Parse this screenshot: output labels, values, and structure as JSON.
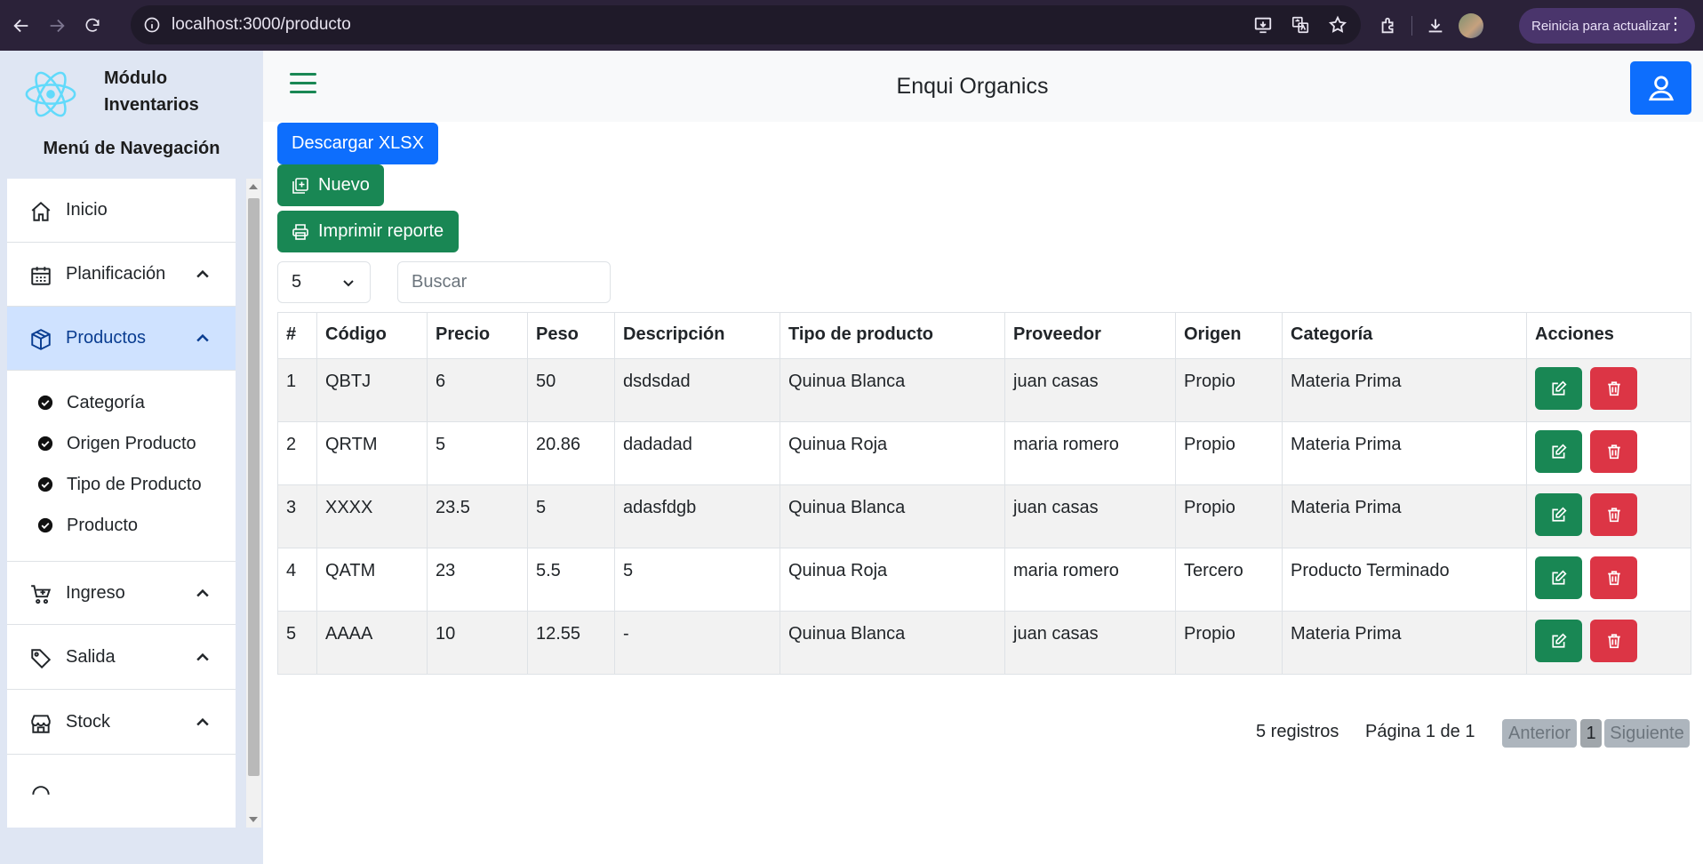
{
  "browser": {
    "url": "localhost:3000/producto",
    "update_label": "Reinicia para actualizar",
    "icons": [
      "back-icon",
      "forward-icon",
      "reload-icon",
      "info-icon",
      "install-icon",
      "translate-icon",
      "star-icon",
      "extensions-icon",
      "download-icon",
      "profile-avatar",
      "menu-dots-icon"
    ]
  },
  "sidebar": {
    "brand_title": "Módulo Inventarios",
    "menu_title": "Menú de Navegación",
    "items": [
      {
        "label": "Inicio",
        "icon": "home-icon"
      },
      {
        "label": "Planificación",
        "icon": "calendar-icon"
      },
      {
        "label": "Productos",
        "icon": "box-icon"
      },
      {
        "label": "Ingreso",
        "icon": "cart-plus-icon"
      },
      {
        "label": "Salida",
        "icon": "tag-icon"
      },
      {
        "label": "Stock",
        "icon": "shop-icon"
      }
    ],
    "subitems": [
      {
        "label": "Categoría"
      },
      {
        "label": "Origen Producto"
      },
      {
        "label": "Tipo de Producto"
      },
      {
        "label": "Producto"
      }
    ]
  },
  "header": {
    "title": "Enqui Organics"
  },
  "toolbar": {
    "download_label": "Descargar XLSX",
    "new_label": "Nuevo",
    "print_label": "Imprimir reporte",
    "page_size": "5",
    "search_placeholder": "Buscar"
  },
  "table": {
    "columns": [
      "#",
      "Código",
      "Precio",
      "Peso",
      "Descripción",
      "Tipo de producto",
      "Proveedor",
      "Origen",
      "Categoría",
      "Acciones"
    ],
    "rows": [
      [
        "1",
        "QBTJ",
        "6",
        "50",
        "dsdsdad",
        "Quinua Blanca",
        "juan casas",
        "Propio",
        "Materia Prima"
      ],
      [
        "2",
        "QRTM",
        "5",
        "20.86",
        "dadadad",
        "Quinua Roja",
        "maria romero",
        "Propio",
        "Materia Prima"
      ],
      [
        "3",
        "XXXX",
        "23.5",
        "5",
        "adasfdgb",
        "Quinua Blanca",
        "juan casas",
        "Propio",
        "Materia Prima"
      ],
      [
        "4",
        "QATM",
        "23",
        "5.5",
        "5",
        "Quinua Roja",
        "maria romero",
        "Tercero",
        "Producto Terminado"
      ],
      [
        "5",
        "AAAA",
        "10",
        "12.55",
        "-",
        "Quinua Blanca",
        "juan casas",
        "Propio",
        "Materia Prima"
      ]
    ]
  },
  "pagination": {
    "records": "5 registros",
    "page_info": "Página 1 de 1",
    "prev_label": "Anterior",
    "current_page": "1",
    "next_label": "Siguiente"
  },
  "colors": {
    "primary": "#0d6efd",
    "success": "#198754",
    "danger": "#dc3545",
    "sidebar_bg": "#dfe6f3",
    "active_bg": "#cfe2ff"
  }
}
